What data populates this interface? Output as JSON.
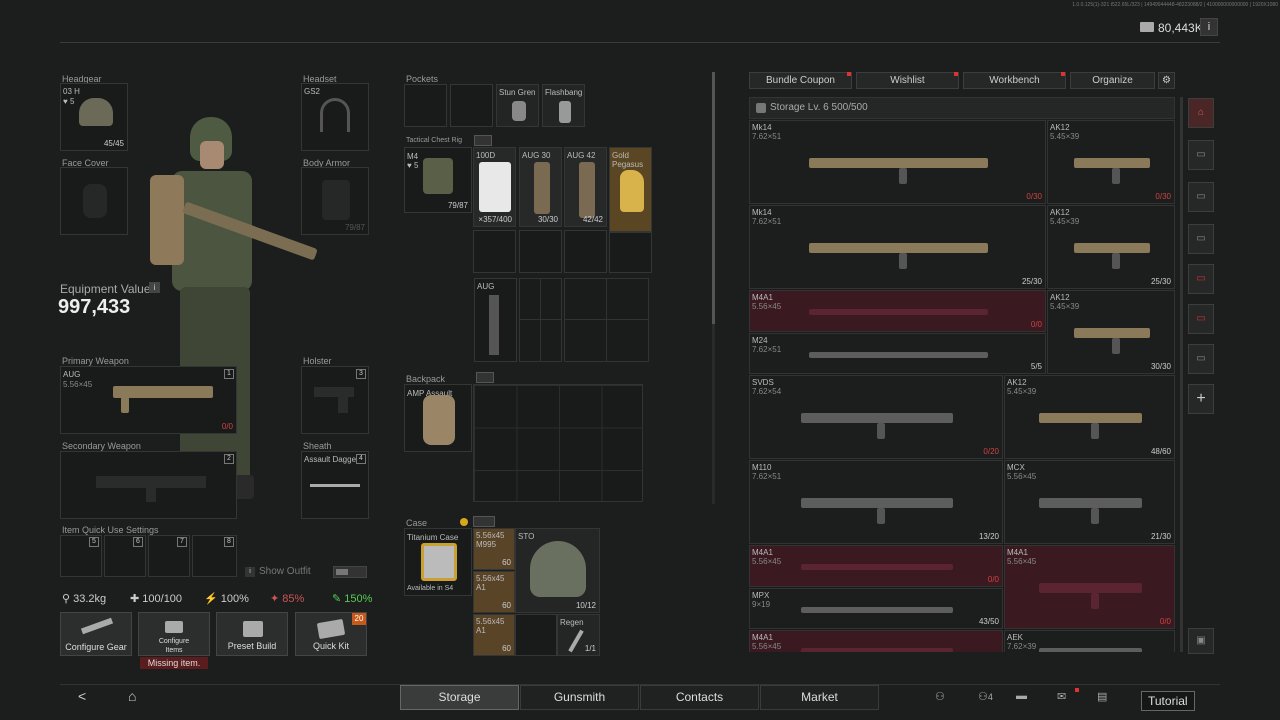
{
  "header": {
    "version_text": "1.0.0.125(1)-321 t522.65L/323 | 14949944448-48223088/2 | 410000000000000 | 1920X1080",
    "currency": "80,443K",
    "info_icon": "i"
  },
  "gear": {
    "headgear": {
      "label": "Headgear",
      "item": "03 H",
      "level": "5",
      "durability": "45/45"
    },
    "face_cover": {
      "label": "Face Cover"
    },
    "headset": {
      "label": "Headset",
      "item": "GS2"
    },
    "body_armor": {
      "label": "Body Armor",
      "durability": "79/87"
    },
    "equipment_value_label": "Equipment Value",
    "equipment_value": "997,433",
    "primary": {
      "label": "Primary Weapon",
      "item": "AUG",
      "caliber": "5.56×45",
      "slot": "1",
      "ammo": "0/0"
    },
    "holster": {
      "label": "Holster",
      "slot": "3"
    },
    "secondary": {
      "label": "Secondary Weapon",
      "slot": "2"
    },
    "sheath": {
      "label": "Sheath",
      "item": "Assault Dagger",
      "slot": "4"
    },
    "quick_use": {
      "label": "Item Quick Use Settings",
      "slots": [
        "5",
        "6",
        "7",
        "8"
      ]
    },
    "show_outfit": "Show Outfit"
  },
  "stats": {
    "weight": "33.2kg",
    "hp": "100/100",
    "stamina": "100%",
    "hunger": "85%",
    "hydration": "150%"
  },
  "actions": {
    "configure_gear": "Configure Gear",
    "configure_items": "Configure Items",
    "missing": "Missing item.",
    "preset_build": "Preset Build",
    "quick_kit": "Quick Kit",
    "quick_kit_badge": "20"
  },
  "pockets": {
    "label": "Pockets",
    "items": [
      "Stun Gren",
      "Flashbang"
    ]
  },
  "rig": {
    "label": "Tactical Chest Rig",
    "item": "M4",
    "level": "5",
    "durability": "79/87",
    "items": [
      {
        "name": "100D",
        "count": "×357/400"
      },
      {
        "name": "AUG 30",
        "count": "30/30"
      },
      {
        "name": "AUG 42",
        "count": "42/42"
      },
      {
        "name": "Gold Pegasus",
        "count": ""
      }
    ],
    "weapon_slot": "AUG"
  },
  "backpack": {
    "label": "Backpack",
    "item": "AMP Assault"
  },
  "case": {
    "label": "Case",
    "item": "Titanium Case",
    "available": "Available in S4",
    "ammo": [
      {
        "name": "5.56x45 M995",
        "count": "60"
      },
      {
        "name": "5.56x45 A1",
        "count": "60"
      },
      {
        "name": "5.56x45 A1",
        "count": "60"
      }
    ],
    "sto": {
      "name": "STO",
      "count": "10/12"
    },
    "regen": {
      "name": "Regen",
      "count": "1/1"
    }
  },
  "storage": {
    "top_buttons": [
      "Bundle Coupon",
      "Wishlist",
      "Workbench",
      "Organize"
    ],
    "title": "Storage Lv. 6  500/500",
    "weapons": [
      {
        "name": "Mk14",
        "cal": "7.62×51",
        "ammo": "0/30",
        "red": false,
        "ammo_red": true
      },
      {
        "name": "AK12",
        "cal": "5.45×39",
        "ammo": "0/30",
        "red": false,
        "ammo_red": true
      },
      {
        "name": "Mk14",
        "cal": "7.62×51",
        "ammo": "25/30",
        "red": false,
        "ammo_red": false
      },
      {
        "name": "AK12",
        "cal": "5.45×39",
        "ammo": "25/30",
        "red": false,
        "ammo_red": false
      },
      {
        "name": "M4A1",
        "cal": "5.56×45",
        "ammo": "0/0",
        "red": true,
        "ammo_red": true
      },
      {
        "name": "AK12",
        "cal": "5.45×39",
        "ammo": "30/30",
        "red": false,
        "ammo_red": false
      },
      {
        "name": "M24",
        "cal": "7.62×51",
        "ammo": "5/5",
        "red": false,
        "ammo_red": false
      },
      {
        "name": "SVDS",
        "cal": "7.62×54",
        "ammo": "0/20",
        "red": false,
        "ammo_red": true
      },
      {
        "name": "AK12",
        "cal": "5.45×39",
        "ammo": "48/60",
        "red": false,
        "ammo_red": false
      },
      {
        "name": "M110",
        "cal": "7.62×51",
        "ammo": "13/20",
        "red": false,
        "ammo_red": false
      },
      {
        "name": "MCX",
        "cal": "5.56×45",
        "ammo": "21/30",
        "red": false,
        "ammo_red": false
      },
      {
        "name": "M4A1",
        "cal": "5.56×45",
        "ammo": "0/0",
        "red": true,
        "ammo_red": true
      },
      {
        "name": "M4A1",
        "cal": "5.56×45",
        "ammo": "0/0",
        "red": true,
        "ammo_red": true
      },
      {
        "name": "MPX",
        "cal": "9×19",
        "ammo": "43/50",
        "red": false,
        "ammo_red": false
      },
      {
        "name": "M4A1",
        "cal": "5.56×45",
        "ammo": "",
        "red": true,
        "ammo_red": false
      },
      {
        "name": "AEK",
        "cal": "7.62×39",
        "ammo": "",
        "red": false,
        "ammo_red": false
      }
    ]
  },
  "nav": {
    "tabs": [
      "Storage",
      "Gunsmith",
      "Contacts",
      "Market"
    ],
    "active": "Storage",
    "tutorial": "Tutorial",
    "friends_count": "4"
  }
}
